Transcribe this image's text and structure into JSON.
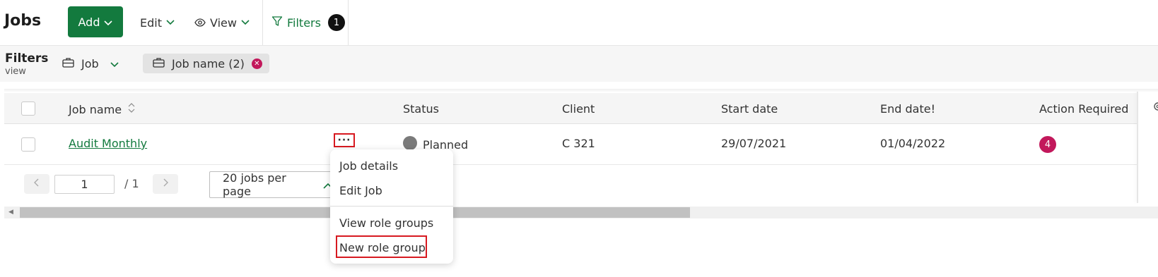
{
  "header": {
    "title": "Jobs",
    "add_label": "Add",
    "edit_label": "Edit",
    "view_label": "View",
    "filters_label": "Filters",
    "filters_count": "1"
  },
  "filterbar": {
    "title": "Filters",
    "subtitle": "view",
    "job_dropdown": "Job",
    "chip_label": "Job name (2)"
  },
  "table": {
    "columns": [
      "Job name",
      "Status",
      "Client",
      "Start date",
      "End date!",
      "Action Required"
    ],
    "rows": [
      {
        "job_name": "Audit Monthly",
        "status": "Planned",
        "client": "C 321",
        "start_date": "29/07/2021",
        "end_date": "01/04/2022",
        "action_required": "4"
      }
    ]
  },
  "pagination": {
    "current_page": "1",
    "of_label": "/  1",
    "per_page_label": "20 jobs per page"
  },
  "row_menu": {
    "trigger": "···",
    "items": [
      "Job details",
      "Edit Job",
      "View role groups",
      "New role group"
    ]
  },
  "colors": {
    "brand_green": "#137a3e",
    "badge_magenta": "#c2185b",
    "highlight_red": "#d71920",
    "status_grey": "#7a7a7a"
  },
  "icons": [
    "chevron-down-icon",
    "eye-icon",
    "filter-icon",
    "briefcase-icon",
    "sort-icon",
    "chevron-left-icon",
    "chevron-right-icon",
    "chevron-up-icon",
    "gear-icon",
    "close-icon"
  ]
}
